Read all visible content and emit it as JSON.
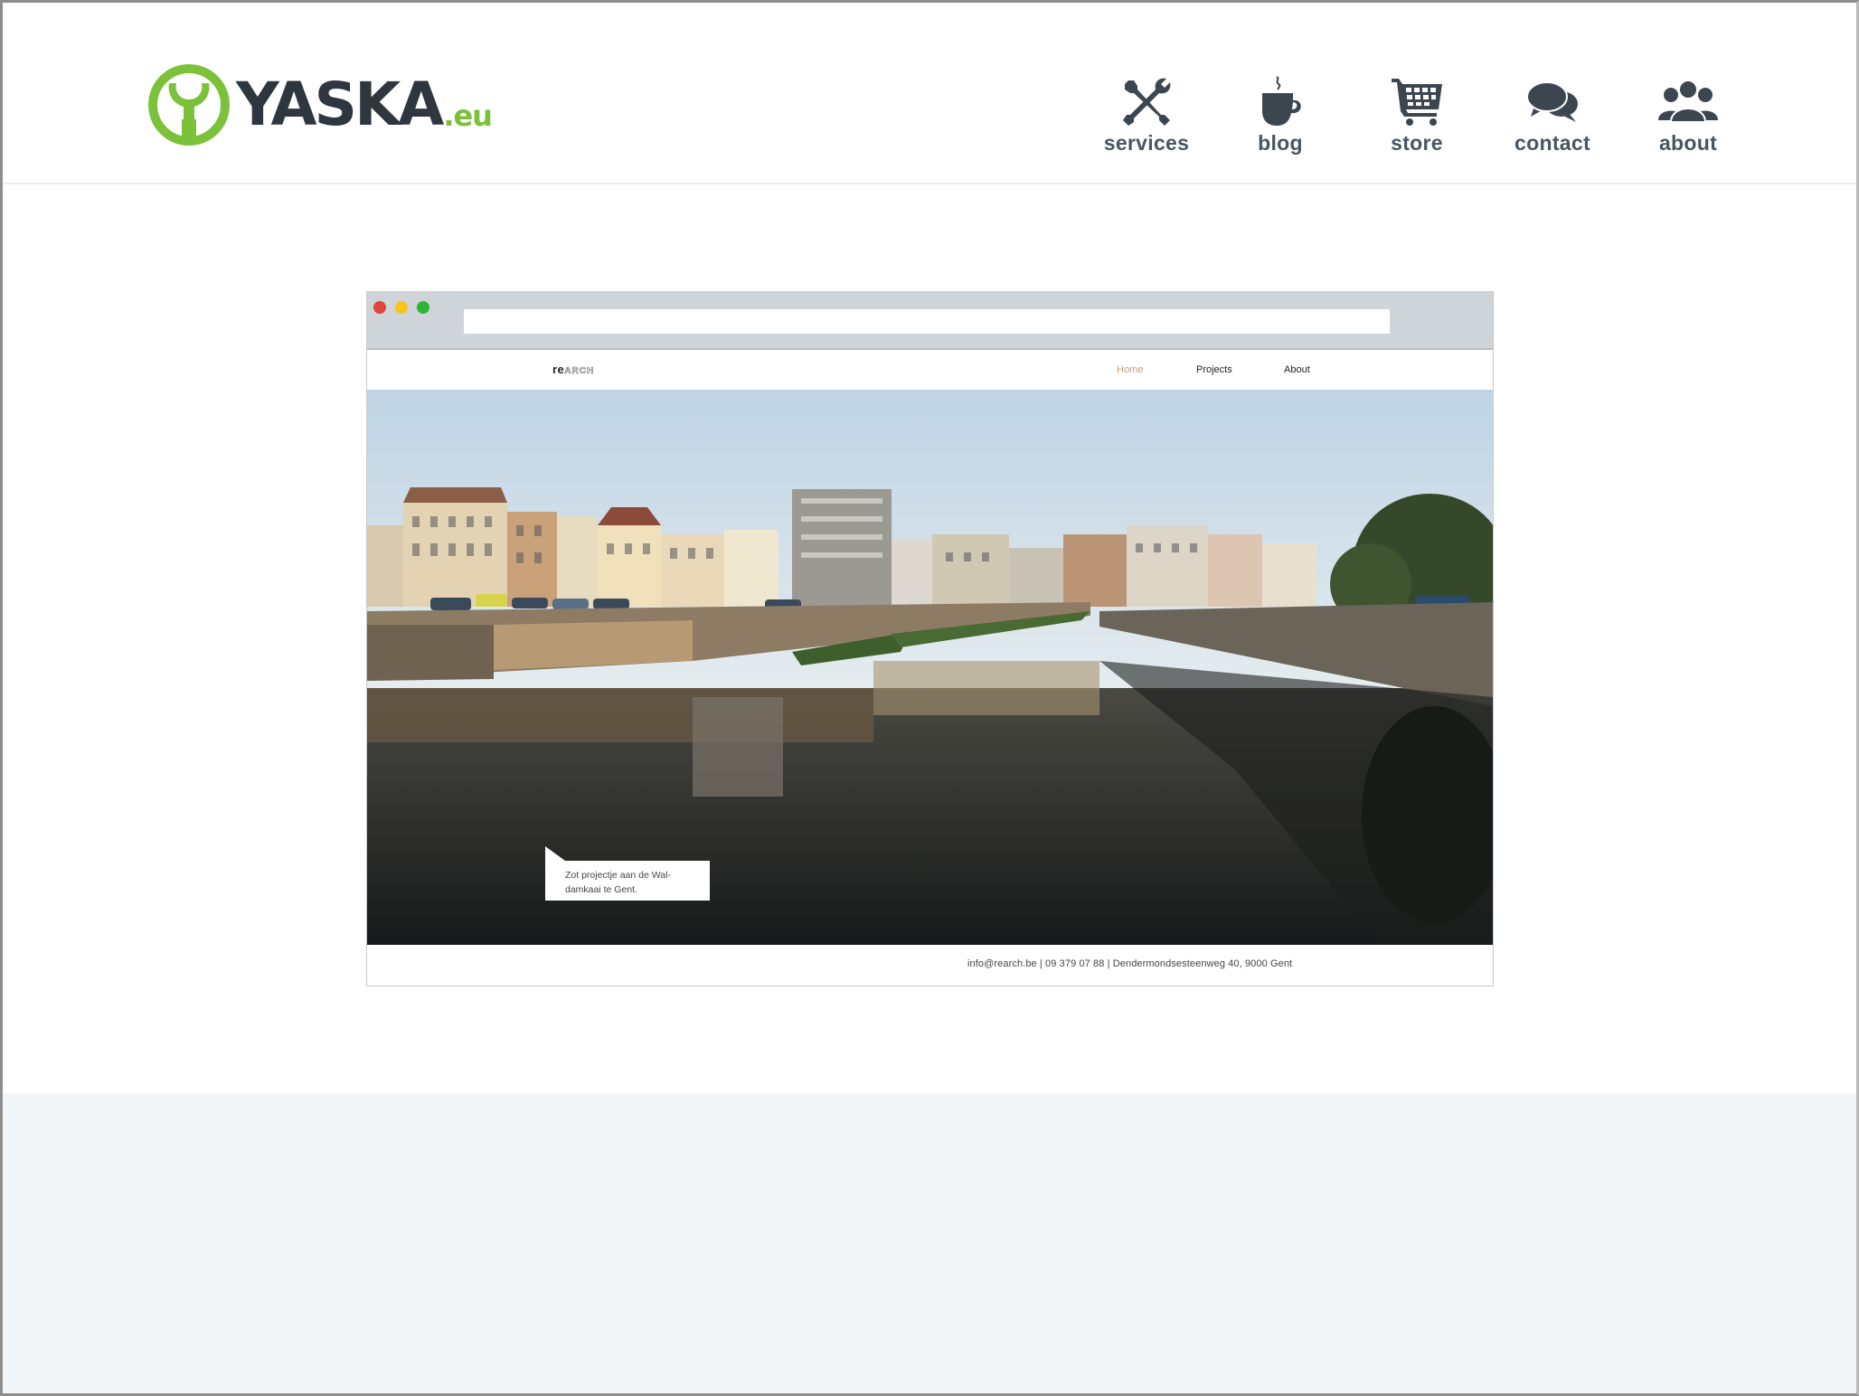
{
  "header": {
    "logo": {
      "text": "YASKA",
      "tld": ".eu",
      "icon": "yaska-wrench-logo"
    },
    "nav": [
      {
        "label": "services",
        "icon": "tools-icon"
      },
      {
        "label": "blog",
        "icon": "coffee-cup-icon"
      },
      {
        "label": "store",
        "icon": "shopping-cart-icon"
      },
      {
        "label": "contact",
        "icon": "speech-bubbles-icon"
      },
      {
        "label": "about",
        "icon": "people-icon"
      }
    ]
  },
  "mockup": {
    "window_dots": [
      "#e0443a",
      "#f5c518",
      "#2fb534"
    ],
    "site": {
      "logo_prefix": "re",
      "logo_suffix": "ARCH",
      "nav": [
        "Home",
        "Projects",
        "About"
      ],
      "active_nav": "Home",
      "active_color": "#c79c7f",
      "caption": "Zot projectje aan de Wal-damkaai te Gent.",
      "footer": "info@rearch.be | 09 379 07 88 | Dendermondsesteenweg 40, 9000 Gent"
    }
  },
  "colors": {
    "brand_green": "#7bc13a",
    "brand_dark": "#2e3640",
    "nav_gray": "#4a5560"
  }
}
